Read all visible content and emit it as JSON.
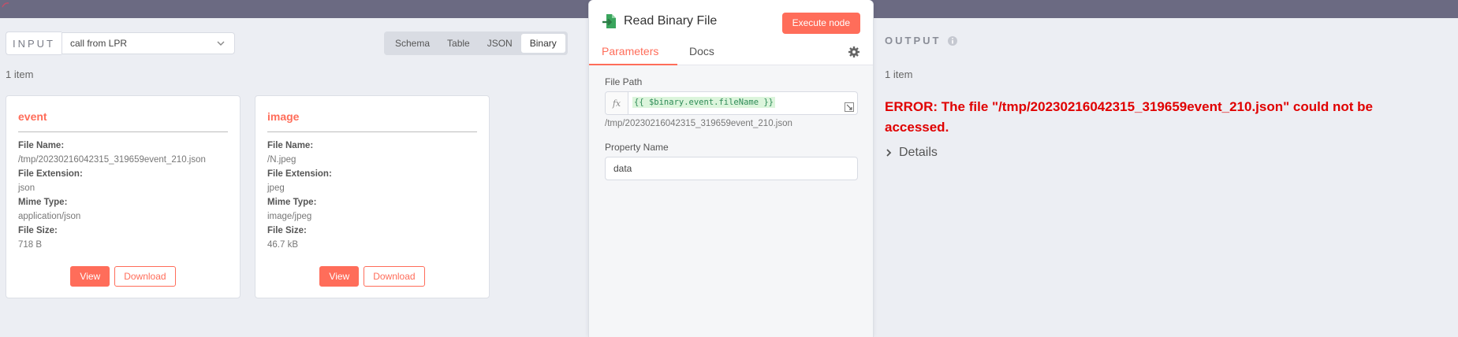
{
  "input": {
    "label": "INPUT",
    "selected_node": "call from LPR",
    "view_tabs": [
      "Schema",
      "Table",
      "JSON",
      "Binary"
    ],
    "active_view": "Binary",
    "items_count": "1 item",
    "cards": [
      {
        "title": "event",
        "file_name_label": "File Name:",
        "file_name": "/tmp/20230216042315_319659event_210.json",
        "file_extension_label": "File Extension:",
        "file_extension": "json",
        "mime_type_label": "Mime Type:",
        "mime_type": "application/json",
        "file_size_label": "File Size:",
        "file_size": "718 B",
        "view_label": "View",
        "download_label": "Download"
      },
      {
        "title": "image",
        "file_name_label": "File Name:",
        "file_name": "/N.jpeg",
        "file_extension_label": "File Extension:",
        "file_extension": "jpeg",
        "mime_type_label": "Mime Type:",
        "mime_type": "image/jpeg",
        "file_size_label": "File Size:",
        "file_size": "46.7 kB",
        "view_label": "View",
        "download_label": "Download"
      }
    ]
  },
  "node": {
    "title": "Read Binary File",
    "execute_label": "Execute node",
    "tabs": [
      "Parameters",
      "Docs"
    ],
    "active_tab": "Parameters",
    "file_path_label": "File Path",
    "fx_label": "fx",
    "file_path_expression": "{{ $binary.event.fileName }}",
    "file_path_resolved": "/tmp/20230216042315_319659event_210.json",
    "property_name_label": "Property Name",
    "property_name_value": "data"
  },
  "output": {
    "label": "OUTPUT",
    "items_count": "1 item",
    "error": "ERROR: The file \"/tmp/20230216042315_319659event_210.json\" could not be accessed.",
    "details_label": "Details"
  },
  "colors": {
    "accent": "#ff6d5a",
    "error": "#e00000",
    "topbar": "#6b6a82",
    "background": "#eceef3"
  }
}
